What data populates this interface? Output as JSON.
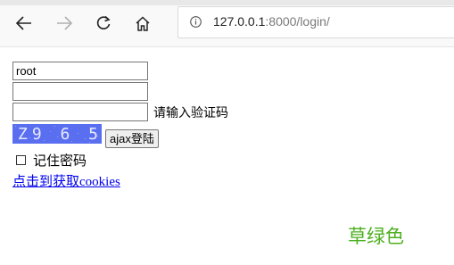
{
  "browser": {
    "url_host": "127.0.0.1",
    "url_rest": ":8000/login/",
    "icons": {
      "back": "back-arrow-icon",
      "forward": "forward-arrow-icon",
      "reload": "reload-icon",
      "home": "home-icon",
      "info": "info-icon"
    }
  },
  "form": {
    "username_value": "root",
    "password_value": "",
    "captcha_input_value": "",
    "captcha_prompt": "请输入验证码",
    "captcha_image_text": "Z9 6 5",
    "ajax_button_label": "ajax登陆",
    "remember_label": "记住密码",
    "remember_checked": false
  },
  "links": {
    "cookie_link": "点击到获取cookies"
  },
  "decor": {
    "green_text": "草绿色",
    "green_color": "#4caf1e",
    "captcha_bg": "#5a6ff0"
  }
}
